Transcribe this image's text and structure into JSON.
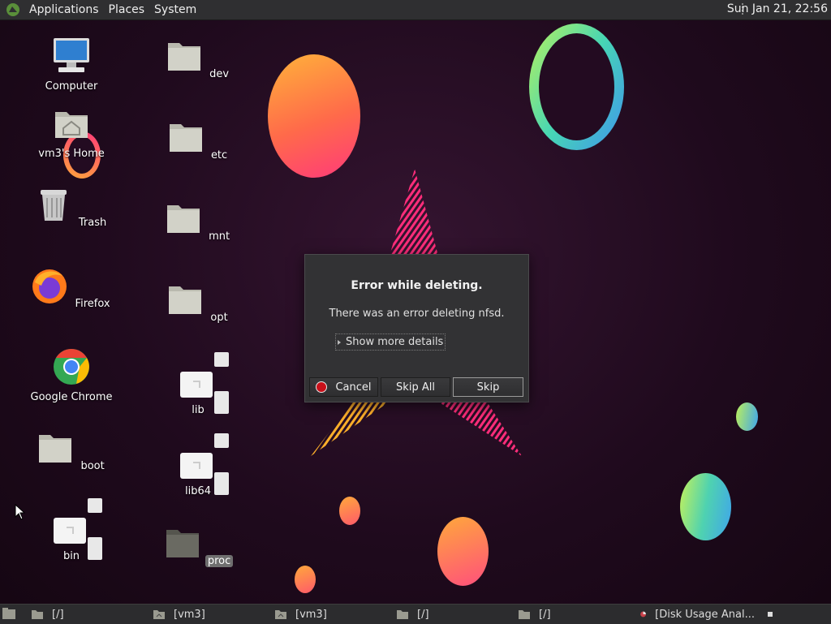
{
  "top_panel": {
    "menus": [
      "Applications",
      "Places",
      "System"
    ],
    "clock": "Sun Jan 21, 22:56"
  },
  "desktop": {
    "col1": [
      {
        "name": "computer",
        "label": "Computer",
        "icon": "computer-icon"
      },
      {
        "name": "home",
        "label": "vm3's Home",
        "icon": "home-folder-icon"
      },
      {
        "name": "trash",
        "label": "Trash",
        "icon": "trash-icon"
      },
      {
        "name": "firefox",
        "label": "Firefox",
        "icon": "firefox-icon"
      },
      {
        "name": "chrome",
        "label": "Google Chrome",
        "icon": "chrome-icon"
      },
      {
        "name": "boot",
        "label": "boot",
        "icon": "folder-icon"
      },
      {
        "name": "bin",
        "label": "bin",
        "icon": "symlink-icon"
      }
    ],
    "col2": [
      {
        "name": "dev",
        "label": "dev",
        "icon": "folder-icon"
      },
      {
        "name": "etc",
        "label": "etc",
        "icon": "folder-icon"
      },
      {
        "name": "mnt",
        "label": "mnt",
        "icon": "folder-icon"
      },
      {
        "name": "opt",
        "label": "opt",
        "icon": "folder-icon"
      },
      {
        "name": "lib",
        "label": "lib",
        "icon": "symlink-icon"
      },
      {
        "name": "lib64",
        "label": "lib64",
        "icon": "symlink-icon"
      },
      {
        "name": "proc",
        "label": "proc",
        "icon": "folder-icon",
        "selected": true
      }
    ]
  },
  "dialog": {
    "title": "Error while deleting.",
    "message": "There was an error deleting nfsd.",
    "details_label": "Show more details",
    "buttons": {
      "cancel": "Cancel",
      "skip_all": "Skip All",
      "skip": "Skip"
    }
  },
  "taskbar": {
    "tasks": [
      {
        "label": "[/]",
        "icon": "folder-icon"
      },
      {
        "label": "[vm3]",
        "icon": "home-folder-icon"
      },
      {
        "label": "[vm3]",
        "icon": "home-folder-icon"
      },
      {
        "label": "[/]",
        "icon": "folder-icon"
      },
      {
        "label": "[/]",
        "icon": "folder-icon"
      },
      {
        "label": "[Disk Usage Anal...",
        "icon": "disk-usage-icon"
      }
    ]
  },
  "colors": {
    "panel": "#2f2f31",
    "dialog_bg": "#323234",
    "cancel_dot": "#c8101a"
  }
}
